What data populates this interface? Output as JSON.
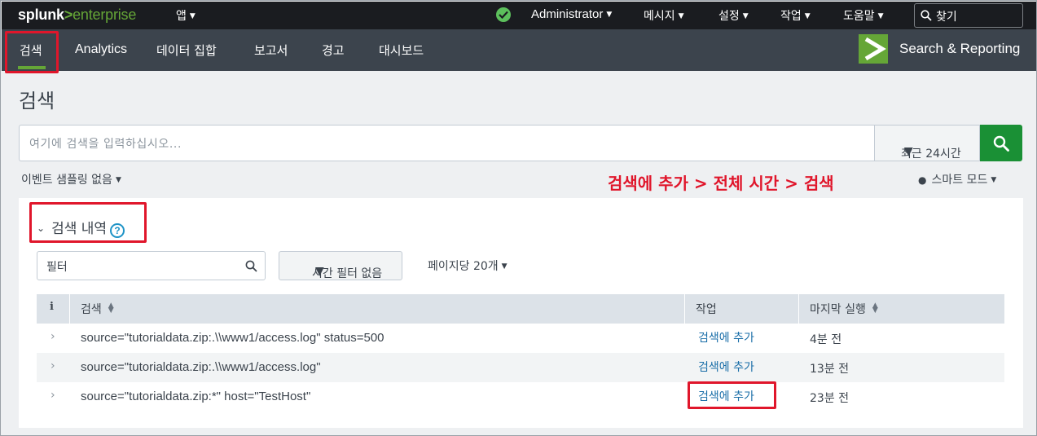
{
  "topbar": {
    "logo": {
      "splunk": "splunk",
      "gt": ">",
      "enterprise": "enterprise"
    },
    "app_menu": "앱",
    "status_icon": "check-circle-icon",
    "user_menu": "Administrator",
    "messages_menu": "메시지",
    "settings_menu": "설정",
    "activity_menu": "작업",
    "help_menu": "도움말",
    "find_label": "찾기"
  },
  "appbar": {
    "tabs": [
      {
        "label": "검색",
        "active": true
      },
      {
        "label": "Analytics"
      },
      {
        "label": "데이터 집합"
      },
      {
        "label": "보고서"
      },
      {
        "label": "경고"
      },
      {
        "label": "대시보드"
      }
    ],
    "app_name": "Search & Reporting",
    "accent_color": "#65a637"
  },
  "page": {
    "title": "검색",
    "search_placeholder": "여기에 검색을 입력하십시오...",
    "time_range": "최근 24시간",
    "sampling": "이벤트 샘플링 없음",
    "annotation": "검색에 추가 > 전체 시간 > 검색",
    "mode": "스마트 모드"
  },
  "history": {
    "title": "검색 내역",
    "filter_placeholder": "필터",
    "time_filter": "시간 필터 없음",
    "per_page": "페이지당 20개",
    "columns": {
      "info": "i",
      "search": "검색",
      "actions": "작업",
      "last_run": "마지막 실행"
    },
    "rows": [
      {
        "query": "source=\"tutorialdata.zip:.\\\\www1/access.log\" status=500",
        "action": "검색에 추가",
        "last_run": "4분 전"
      },
      {
        "query": "source=\"tutorialdata.zip:.\\\\www1/access.log\"",
        "action": "검색에 추가",
        "last_run": "13분 전"
      },
      {
        "query": "source=\"tutorialdata.zip:*\" host=\"TestHost\"",
        "action": "검색에 추가",
        "last_run": "23분 전"
      }
    ]
  },
  "colors": {
    "highlight": "#e0162b",
    "search_button": "#1a9035",
    "link": "#1a6ea8"
  }
}
